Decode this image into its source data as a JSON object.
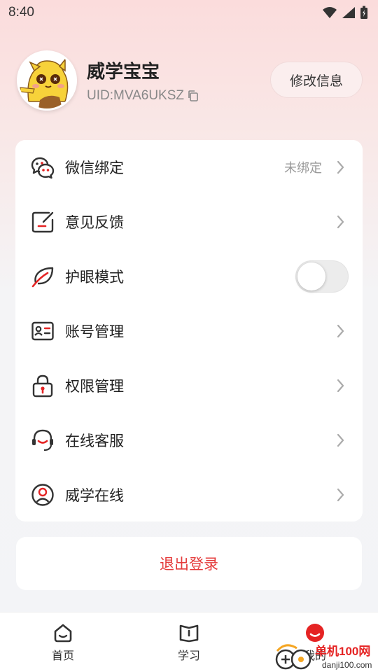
{
  "status": {
    "time": "8:40"
  },
  "profile": {
    "name": "威学宝宝",
    "uid": "UID:MVA6UKSZ",
    "edit_label": "修改信息"
  },
  "menu": [
    {
      "label": "微信绑定",
      "value": "未绑定",
      "icon": "wechat-icon"
    },
    {
      "label": "意见反馈",
      "icon": "feedback-icon"
    },
    {
      "label": "护眼模式",
      "icon": "leaf-icon",
      "toggle": false
    },
    {
      "label": "账号管理",
      "icon": "id-card-icon"
    },
    {
      "label": "权限管理",
      "icon": "lock-icon"
    },
    {
      "label": "在线客服",
      "icon": "headset-icon"
    },
    {
      "label": "威学在线",
      "icon": "user-circle-icon"
    }
  ],
  "logout_label": "退出登录",
  "nav": [
    {
      "label": "首页",
      "icon": "home-icon"
    },
    {
      "label": "学习",
      "icon": "book-icon"
    },
    {
      "label": "我的",
      "icon": "profile-icon"
    }
  ],
  "watermark": {
    "text_main": "单机100网",
    "text_sub": "danji100.com"
  },
  "colors": {
    "accent": "#e43b3b",
    "badge": "#e52424"
  }
}
